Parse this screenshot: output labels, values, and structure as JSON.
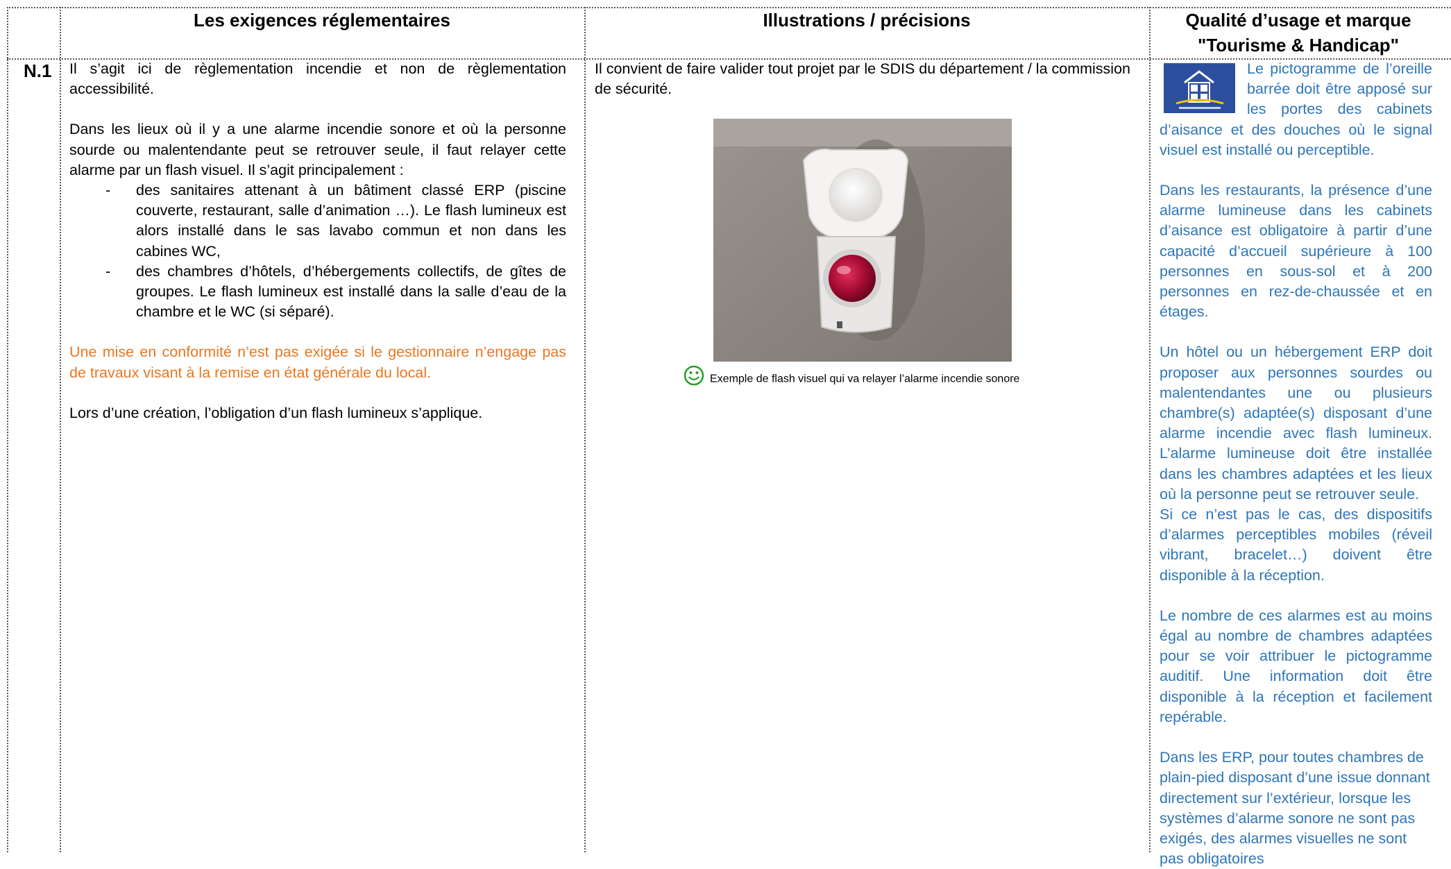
{
  "headers": {
    "col1": "Les exigences réglementaires",
    "col2": "Illustrations / précisions",
    "col3": "Qualité d’usage et marque \"Tourisme & Handicap\""
  },
  "row": {
    "label": "N.1",
    "requirements": {
      "p1": "Il s’agit ici de règlementation incendie et non de règlementation accessibilité.",
      "p2": "Dans les lieux où il y a une alarme incendie sonore et où la personne sourde ou malentendante peut se retrouver seule, il faut relayer cette alarme par un flash visuel. Il s’agit principalement :",
      "items": [
        "des sanitaires attenant à un bâtiment classé ERP (piscine couverte, restaurant, salle d’animation …). Le flash lumineux est alors installé dans le sas lavabo commun et non dans les cabines WC,",
        "des chambres d’hôtels, d’hébergements collectifs, de gîtes de groupes. Le flash lumineux est installé dans la salle d’eau de la chambre et le WC (si séparé)."
      ],
      "dash": "-",
      "warning": "Une mise en conformité n’est pas exigée si le gestionnaire n’engage pas de travaux visant à la remise en état générale du local.",
      "p3": "Lors d’une création, l’obligation d’un flash lumineux s’applique."
    },
    "illustrations": {
      "intro": "Il convient de faire valider tout projet par le SDIS du département / la commission de sécurité.",
      "caption": "Exemple de flash visuel qui va relayer l’alarme incendie sonore",
      "photo_icon": "flash-alarm-photo",
      "caption_icon": "smiley-icon"
    },
    "quality": {
      "logo_icon": "tourisme-handicap-logo",
      "p1": "Le pictogramme de l’oreille barrée doit être apposé sur les portes des cabinets d’aisance et des douches où le signal visuel est installé ou perceptible.",
      "p2": "Dans les restaurants, la présence d’une alarme lumineuse dans les cabinets d’aisance est obligatoire à partir d’une capacité d’accueil supérieure à 100 personnes en sous-sol et à 200 personnes en rez-de-chaussée et en étages.",
      "p3": "Un hôtel ou un hébergement ERP doit proposer aux personnes sourdes ou malentendantes une ou plusieurs chambre(s) adaptée(s) disposant d’une alarme incendie avec flash lumineux. L’alarme lumineuse doit être installée dans les chambres adaptées et les lieux où la personne peut se retrouver seule.",
      "p4": "Si ce n’est pas le cas, des dispositifs d’alarmes perceptibles mobiles (réveil vibrant, bracelet…) doivent être disponible à la réception.",
      "p5": "Le nombre de ces alarmes est au moins égal au nombre de chambres adaptées pour se voir attribuer le pictogramme auditif. Une information doit être disponible à la réception et facilement repérable.",
      "p6": "Dans les ERP, pour toutes chambres de plain-pied disposant d’une issue donnant directement sur l’extérieur, lorsque les systèmes d’alarme sonore ne sont pas exigés, des alarmes visuelles ne sont pas obligatoires"
    },
    "colors": {
      "orange": "#e87722",
      "blue": "#2e75b6"
    }
  }
}
